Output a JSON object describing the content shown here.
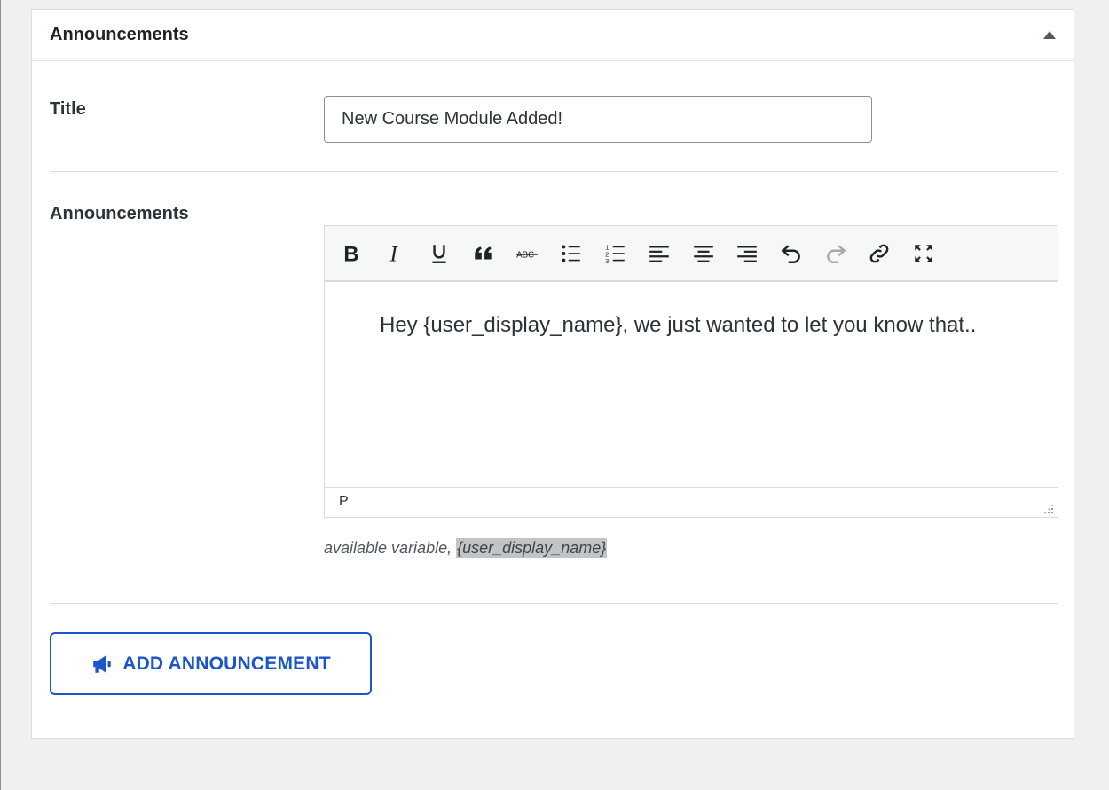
{
  "panel": {
    "title": "Announcements",
    "toggle_icon": "triangle-up-icon"
  },
  "form": {
    "title_label": "Title",
    "title_value": "New Course Module Added!",
    "announcements_label": "Announcements"
  },
  "editor": {
    "toolbar": [
      {
        "name": "bold-icon"
      },
      {
        "name": "italic-icon"
      },
      {
        "name": "underline-icon"
      },
      {
        "name": "blockquote-icon"
      },
      {
        "name": "strikethrough-icon",
        "label": "ABC"
      },
      {
        "name": "bullet-list-icon"
      },
      {
        "name": "numbered-list-icon"
      },
      {
        "name": "align-left-icon"
      },
      {
        "name": "align-center-icon"
      },
      {
        "name": "align-right-icon"
      },
      {
        "name": "undo-icon"
      },
      {
        "name": "redo-icon",
        "disabled": true
      },
      {
        "name": "link-icon"
      },
      {
        "name": "fullscreen-icon"
      }
    ],
    "content": "Hey {user_display_name}, we just wanted to let you know that..",
    "path": "P"
  },
  "hint": {
    "prefix": "available variable,",
    "variable": "{user_display_name}"
  },
  "add_button": {
    "label": "ADD ANNOUNCEMENT",
    "icon": "megaphone-icon"
  },
  "colors": {
    "accent": "#1a55c9",
    "background": "#f0f0f1"
  }
}
